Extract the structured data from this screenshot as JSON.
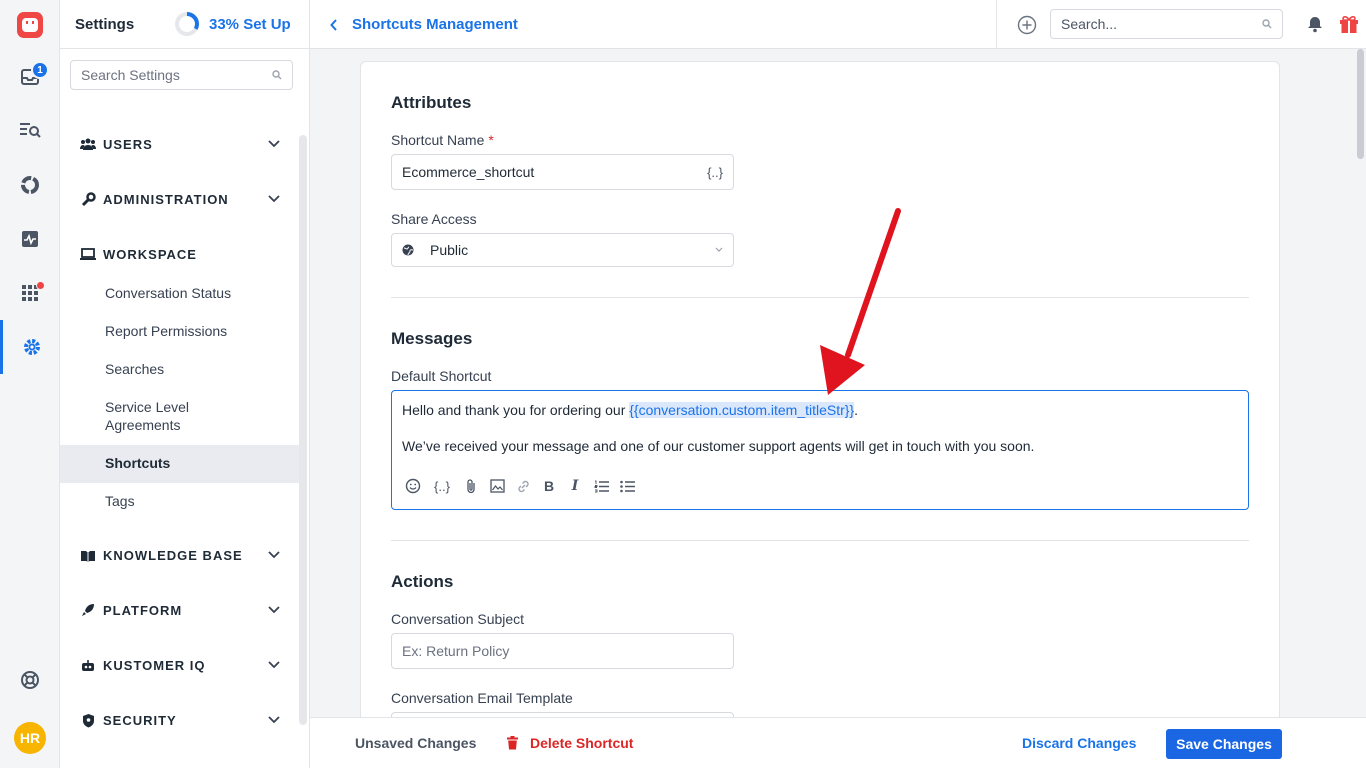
{
  "rail": {
    "inbox_badge": "1",
    "avatar_initials": "HR"
  },
  "sidebar": {
    "title": "Settings",
    "setup_progress": "33% Set Up",
    "setup_fraction": 0.33,
    "search_placeholder": "Search Settings",
    "sections": {
      "users": "USERS",
      "administration": "ADMINISTRATION",
      "workspace": "WORKSPACE",
      "knowledge_base": "KNOWLEDGE BASE",
      "platform": "PLATFORM",
      "kustomer_iq": "KUSTOMER IQ",
      "security": "SECURITY"
    },
    "workspace_items": {
      "conversation_status": "Conversation Status",
      "report_permissions": "Report Permissions",
      "searches": "Searches",
      "service_level_agreements": "Service Level Agreements",
      "shortcuts": "Shortcuts",
      "tags": "Tags"
    }
  },
  "header": {
    "breadcrumb": "Shortcuts Management",
    "search_placeholder": "Search..."
  },
  "form": {
    "attributes_title": "Attributes",
    "shortcut_name_label": "Shortcut Name",
    "required_mark": "*",
    "shortcut_name_value": "Ecommerce_shortcut",
    "variable_symbol": "{..}",
    "share_access_label": "Share Access",
    "share_access_value": "Public",
    "messages_title": "Messages",
    "default_shortcut_label": "Default Shortcut",
    "message_line1_prefix": "Hello and thank you for ordering our ",
    "message_token": "{{conversation.custom.item_titleStr}}",
    "message_line1_suffix": ".",
    "message_line2": "We’ve received your message and one of our customer support agents will get in touch with you soon.",
    "actions_title": "Actions",
    "conversation_subject_label": "Conversation Subject",
    "conversation_subject_placeholder": "Ex: Return Policy",
    "conversation_email_template_label": "Conversation Email Template"
  },
  "footer": {
    "unsaved": "Unsaved Changes",
    "delete": "Delete Shortcut",
    "discard": "Discard Changes",
    "save": "Save Changes"
  },
  "colors": {
    "accent": "#1a73e8",
    "danger": "#dc2626",
    "annotation_arrow": "#e0141e"
  }
}
